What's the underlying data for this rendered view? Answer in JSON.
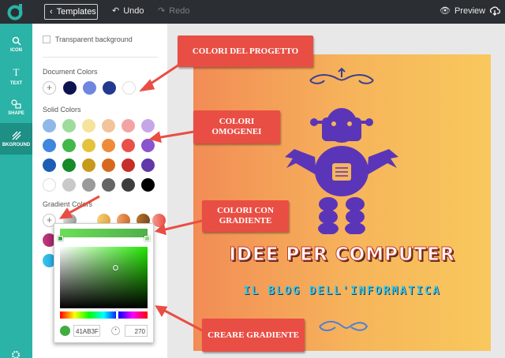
{
  "topbar": {
    "templates_label": "Templates",
    "undo_label": "Undo",
    "redo_label": "Redo",
    "preview_label": "Preview"
  },
  "sidebar": {
    "items": [
      {
        "label": "ICON",
        "icon": "search-icon"
      },
      {
        "label": "TEXT",
        "icon": "text-icon"
      },
      {
        "label": "SHAPE",
        "icon": "shapes-icon"
      },
      {
        "label": "BKGROUND",
        "icon": "background-icon",
        "active": true
      }
    ]
  },
  "panel": {
    "transparent_label": "Transparent background",
    "document_colors_label": "Document Colors",
    "solid_colors_label": "Solid Colors",
    "gradient_colors_label": "Gradient Colors",
    "document_colors": [
      "#0c1450",
      "#6e86e0",
      "#23398f",
      "#ffffff"
    ],
    "solid_colors": [
      [
        "#8fb8e8",
        "#9edc9b",
        "#f5e39b",
        "#f3c39b",
        "#f3a3a3",
        "#c6a7e6"
      ],
      [
        "#3f86dd",
        "#42b84a",
        "#e5c23c",
        "#ef8a38",
        "#e9504a",
        "#8a55cc"
      ],
      [
        "#1c5eb5",
        "#178a2a",
        "#c79a1c",
        "#d7691e",
        "#c72e2a",
        "#6237a9"
      ],
      [
        "#ffffff",
        "#c9c9c9",
        "#9a9a9a",
        "#666666",
        "#3e3e3e",
        "#000000"
      ]
    ]
  },
  "picker": {
    "hex_value": "41AB3F",
    "angle_value": "270"
  },
  "design": {
    "title": "IDEE PER COMPUTER",
    "subtitle": "IL BLOG DELL'INFORMATICA"
  },
  "callouts": {
    "project_colors": "COLORI DEL PROGETTO",
    "solid_colors": "COLORI OMOGENEI",
    "gradient_colors": "COLORI CON GRADIENTE",
    "create_gradient": "CREARE GRADIENTE"
  }
}
